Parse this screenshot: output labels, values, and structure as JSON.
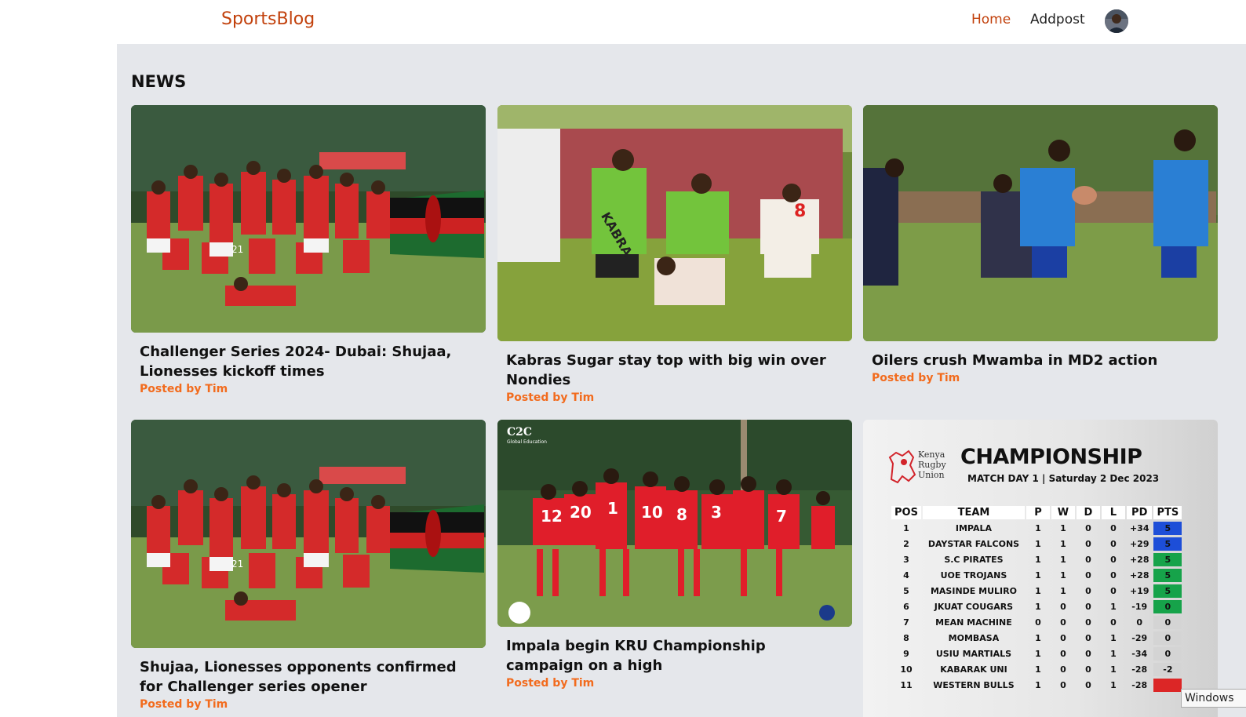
{
  "header": {
    "brand": "SportsBlog",
    "nav": {
      "home": "Home",
      "addpost": "Addpost"
    }
  },
  "section_title": "NEWS",
  "posts": [
    {
      "title": "Challenger Series 2024- Dubai: Shujaa, Lionesses kickoff times",
      "byline": "Posted by Tim"
    },
    {
      "title": "Kabras Sugar stay top with big win over Nondies",
      "byline": "Posted by Tim"
    },
    {
      "title": "Oilers crush Mwamba in MD2 action",
      "byline": "Posted by Tim"
    },
    {
      "title": "Shujaa, Lionesses opponents confirmed for Challenger series opener",
      "byline": "Posted by Tim"
    },
    {
      "title": "Impala begin KRU Championship campaign on a high",
      "byline": "Posted by Tim"
    }
  ],
  "image_texts": {
    "c2c": "C2C",
    "c2c_sub": "Global Education",
    "kabras_shirt": "KABRA",
    "jersey_numbers": [
      "21",
      "8",
      "12",
      "20",
      "1",
      "10",
      "8",
      "3",
      "7"
    ]
  },
  "standings_card": {
    "org_lines": [
      "Kenya",
      "Rugby",
      "Union"
    ],
    "heading": "CHAMPIONSHIP",
    "subheading": "MATCH DAY 1 | Saturday 2 Dec 2023",
    "columns": [
      "POS",
      "TEAM",
      "P",
      "W",
      "D",
      "L",
      "PD",
      "PTS"
    ],
    "rows": [
      {
        "pos": "1",
        "team": "IMPALA",
        "p": "1",
        "w": "1",
        "d": "0",
        "l": "0",
        "pd": "+34",
        "pts": "5",
        "pts_color": "#1d4ed8"
      },
      {
        "pos": "2",
        "team": "DAYSTAR FALCONS",
        "p": "1",
        "w": "1",
        "d": "0",
        "l": "0",
        "pd": "+29",
        "pts": "5",
        "pts_color": "#1d4ed8"
      },
      {
        "pos": "3",
        "team": "S.C PIRATES",
        "p": "1",
        "w": "1",
        "d": "0",
        "l": "0",
        "pd": "+28",
        "pts": "5",
        "pts_color": "#16a34a"
      },
      {
        "pos": "4",
        "team": "UOE TROJANS",
        "p": "1",
        "w": "1",
        "d": "0",
        "l": "0",
        "pd": "+28",
        "pts": "5",
        "pts_color": "#16a34a"
      },
      {
        "pos": "5",
        "team": "MASINDE MULIRO",
        "p": "1",
        "w": "1",
        "d": "0",
        "l": "0",
        "pd": "+19",
        "pts": "5",
        "pts_color": "#16a34a"
      },
      {
        "pos": "6",
        "team": "JKUAT COUGARS",
        "p": "1",
        "w": "0",
        "d": "0",
        "l": "1",
        "pd": "-19",
        "pts": "0",
        "pts_color": "#16a34a"
      },
      {
        "pos": "7",
        "team": "MEAN MACHINE",
        "p": "0",
        "w": "0",
        "d": "0",
        "l": "0",
        "pd": "0",
        "pts": "0",
        "pts_color": "#d4d4d4"
      },
      {
        "pos": "8",
        "team": "MOMBASA",
        "p": "1",
        "w": "0",
        "d": "0",
        "l": "1",
        "pd": "-29",
        "pts": "0",
        "pts_color": "#d4d4d4"
      },
      {
        "pos": "9",
        "team": "USIU MARTIALS",
        "p": "1",
        "w": "0",
        "d": "0",
        "l": "1",
        "pd": "-34",
        "pts": "0",
        "pts_color": "#d4d4d4"
      },
      {
        "pos": "10",
        "team": "KABARAK UNI",
        "p": "1",
        "w": "0",
        "d": "0",
        "l": "1",
        "pd": "-28",
        "pts": "-2",
        "pts_color": "#d4d4d4"
      },
      {
        "pos": "11",
        "team": "WESTERN BULLS",
        "p": "1",
        "w": "0",
        "d": "0",
        "l": "1",
        "pd": "-28",
        "pts": "",
        "pts_color": "#dc2626"
      }
    ]
  },
  "os_overlay": "Windows"
}
